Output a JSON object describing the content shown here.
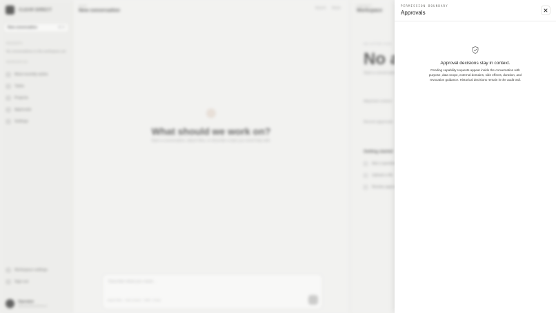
{
  "sidebar": {
    "brand": "CLEAR DIRECT",
    "new_conversation": "New conversation",
    "shortcut": "⌘ N",
    "section_recent": "RECENTS",
    "recent_empty": "No conversations in this workspace yet",
    "section_workspace": "WORKSPACE",
    "nav": [
      "Most recently active",
      "Tasks",
      "Projects",
      "Approvals",
      "Settings"
    ],
    "help": "Workspace settings",
    "signout": "Sign out",
    "user_name": "Operator",
    "user_sub": "operator@workspace"
  },
  "main": {
    "crumb": "CHAT",
    "title": "New conversation",
    "tools": [
      "Search",
      "Share"
    ],
    "hero_title": "What should we work on?",
    "hero_sub": "Start a conversation, attach files, or describe a task you need help with.",
    "composer_placeholder": "Describe what you need...",
    "composer_hint": "Attach files · Add context · Shift + Enter"
  },
  "right_panel": {
    "crumb": "CONTEXT",
    "title": "Workspace",
    "kicker": "NO ACTIVE TASK",
    "big": "No active task",
    "line1": "Start a conversation to see task details.",
    "field1": "Attached context",
    "field2": "Recent approvals",
    "section": "Getting started",
    "items": [
      "Ask a question",
      "Upload a file",
      "Review approvals"
    ]
  },
  "drawer": {
    "eyebrow": "PERMISSION BOUNDARY",
    "title": "Approvals",
    "empty_title": "Approval decisions stay in context.",
    "empty_body": "Pending capability requests appear inside the conversation with purpose, data scope, external domains, side effects, duration, and revocation guidance. Historical decisions remain in the audit trail."
  },
  "icons": {
    "close": "close-icon",
    "shield": "shield-check-icon"
  },
  "colors": {
    "drawer_bg": "#ffffff",
    "backdrop": "#f4f4f3",
    "text": "#1a1a1a"
  }
}
